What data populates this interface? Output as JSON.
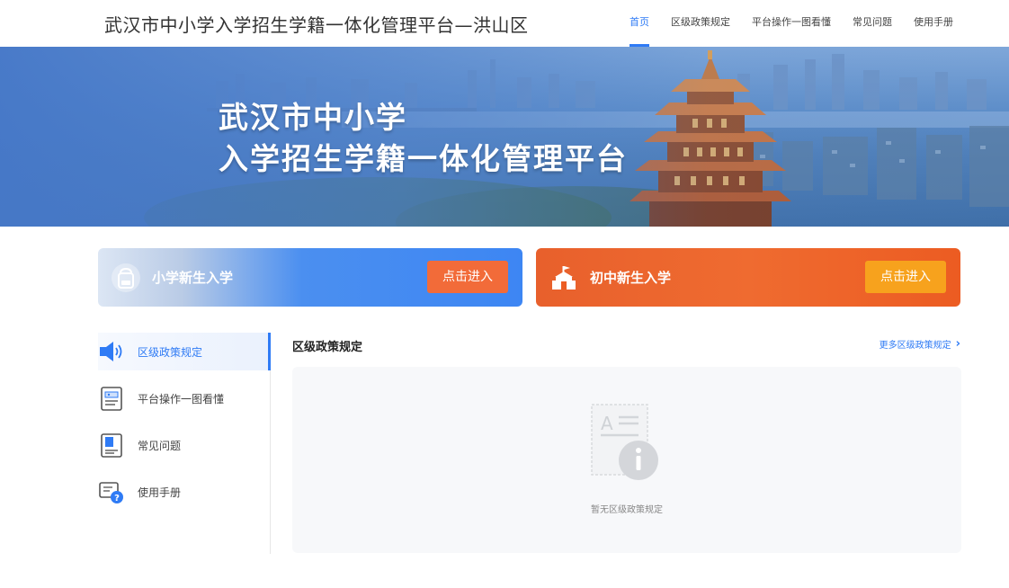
{
  "header": {
    "site_title": "武汉市中小学入学招生学籍一体化管理平台—洪山区",
    "nav": [
      {
        "label": "首页",
        "active": true
      },
      {
        "label": "区级政策规定",
        "active": false
      },
      {
        "label": "平台操作一图看懂",
        "active": false
      },
      {
        "label": "常见问题",
        "active": false
      },
      {
        "label": "使用手册",
        "active": false
      }
    ]
  },
  "banner": {
    "line1": "武汉市中小学",
    "line2": "入学招生学籍一体化管理平台"
  },
  "entries": {
    "primary": {
      "label": "小学新生入学",
      "button": "点击进入",
      "icon": "school-bag-icon"
    },
    "middle": {
      "label": "初中新生入学",
      "button": "点击进入",
      "icon": "school-building-icon"
    }
  },
  "sidebar": {
    "items": [
      {
        "label": "区级政策规定",
        "icon": "speaker-icon",
        "active": true
      },
      {
        "label": "平台操作一图看懂",
        "icon": "document-guide-icon",
        "active": false
      },
      {
        "label": "常见问题",
        "icon": "faq-book-icon",
        "active": false
      },
      {
        "label": "使用手册",
        "icon": "manual-help-icon",
        "active": false
      }
    ]
  },
  "main": {
    "title": "区级政策规定",
    "more_link": "更多区级政策规定",
    "empty_text": "暂无区级政策规定"
  },
  "colors": {
    "accent": "#2f7bf5",
    "orange_button": "#f26b39",
    "yellow_button": "#f7a21d",
    "middle_card": "#ec5c22"
  }
}
